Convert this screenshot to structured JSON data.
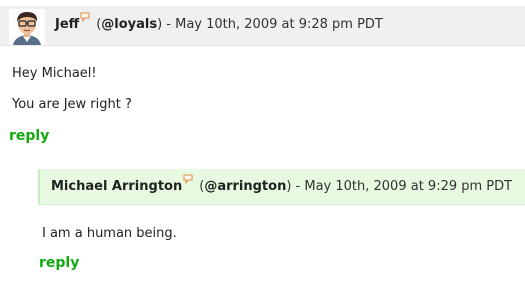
{
  "comments": [
    {
      "author": "Jeff",
      "handle_open": "(",
      "handle": "@loyals",
      "handle_close": ")",
      "timestamp": " - May 10th, 2009 at 9:28 pm PDT",
      "avatar_icon": "cartoon-avatar-glasses",
      "paragraphs": [
        "Hey Michael!",
        "You are Jew right ?"
      ],
      "reply_label": "reply"
    },
    {
      "author": "Michael Arrington",
      "handle_open": "(",
      "handle": "@arrington",
      "handle_close": ")",
      "timestamp": " - May 10th, 2009 at 9:29 pm PDT",
      "paragraphs": [
        "I am a human being."
      ],
      "reply_label": "reply"
    }
  ],
  "icons": {
    "speech": "speech-bubble-icon"
  },
  "colors": {
    "header_bg": "#f0f0f0",
    "reply_header_bg": "#e8f9e2",
    "reply_link": "#11aa11",
    "speech_icon": "#e08a3c"
  }
}
